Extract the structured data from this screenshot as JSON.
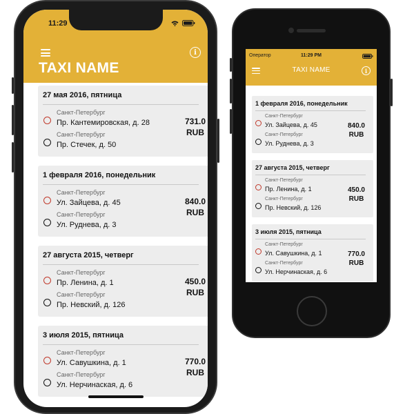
{
  "phone_a": {
    "status": {
      "time": "11:29"
    },
    "title": "TAXI NAME",
    "rides": [
      {
        "date": "27 мая 2016, пятница",
        "from": {
          "city": "Санкт-Петербург",
          "address": "Пр. Кантемировская, д. 28"
        },
        "to": {
          "city": "Санкт-Петербург",
          "address": "Пр. Стечек, д. 50"
        },
        "price": "731.0",
        "currency": "RUB"
      },
      {
        "date": "1 февраля 2016, понедельник",
        "from": {
          "city": "Санкт-Петербург",
          "address": "Ул. Зайцева, д. 45"
        },
        "to": {
          "city": "Санкт-Петербург",
          "address": "Ул. Руднева, д. 3"
        },
        "price": "840.0",
        "currency": "RUB"
      },
      {
        "date": "27 августа 2015, четверг",
        "from": {
          "city": "Санкт-Петербург",
          "address": "Пр. Ленина, д. 1"
        },
        "to": {
          "city": "Санкт-Петербург",
          "address": "Пр. Невский, д. 126"
        },
        "price": "450.0",
        "currency": "RUB"
      },
      {
        "date": "3 июля 2015, пятница",
        "from": {
          "city": "Санкт-Петербург",
          "address": "Ул. Савушкина, д. 1"
        },
        "to": {
          "city": "Санкт-Петербург",
          "address": "Ул. Нерчинаская, д. 6"
        },
        "price": "770.0",
        "currency": "RUB"
      }
    ]
  },
  "phone_b": {
    "status": {
      "carrier": "Оператор",
      "time": "11:29 PM"
    },
    "title": "TAXI NAME",
    "rides": [
      {
        "date": "1 февраля 2016, понедельник",
        "from": {
          "city": "Санкт-Петербург",
          "address": "Ул. Зайцева, д. 45"
        },
        "to": {
          "city": "Санкт-Петербург",
          "address": "Ул. Руднева, д. 3"
        },
        "price": "840.0",
        "currency": "RUB"
      },
      {
        "date": "27 августа 2015, четверг",
        "from": {
          "city": "Санкт-Петербург",
          "address": "Пр. Ленина, д. 1"
        },
        "to": {
          "city": "Санкт-Петербург",
          "address": "Пр. Невский, д. 126"
        },
        "price": "450.0",
        "currency": "RUB"
      },
      {
        "date": "3 июля 2015, пятница",
        "from": {
          "city": "Санкт-Петербург",
          "address": "Ул. Савушкина, д. 1"
        },
        "to": {
          "city": "Санкт-Петербург",
          "address": "Ул. Нерчинаская, д. 6"
        },
        "price": "770.0",
        "currency": "RUB"
      }
    ]
  },
  "icons": {
    "menu": "menu-icon",
    "info": "info-icon",
    "wifi": "wifi-icon",
    "battery": "battery-icon",
    "pickup": "pickup-marker-icon",
    "dropoff": "dropoff-marker-icon"
  },
  "colors": {
    "accent": "#e3b137",
    "pickup": "#c0392b",
    "dropoff": "#111111",
    "card": "#ededed"
  }
}
